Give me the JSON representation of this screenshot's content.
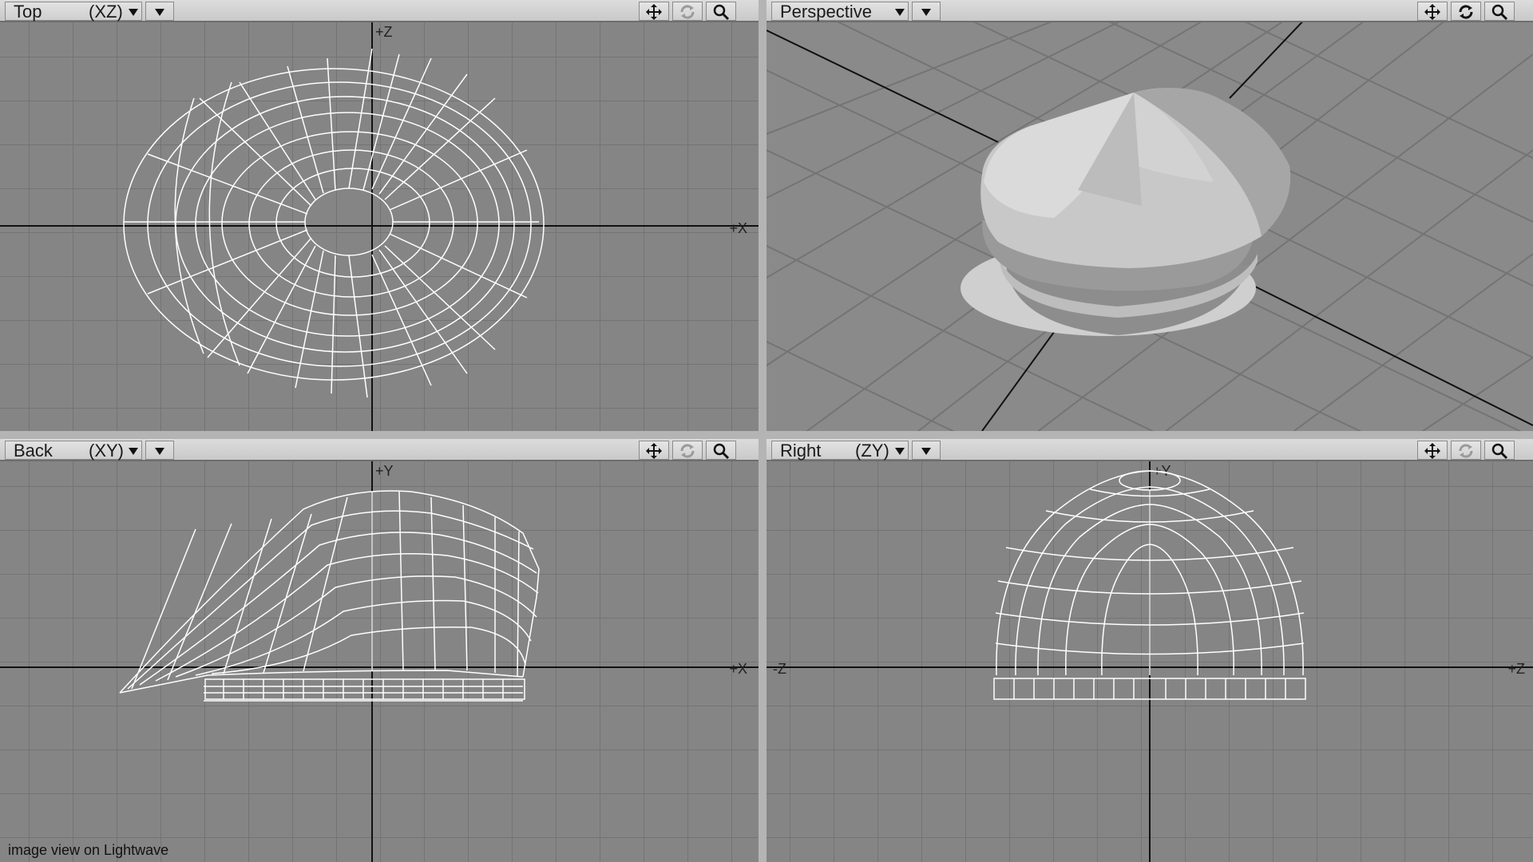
{
  "viewports": {
    "top": {
      "name": "Top",
      "axes": "(XZ)",
      "pos_x": "+X",
      "pos_z": "+Z"
    },
    "perspective": {
      "name": "Perspective"
    },
    "back": {
      "name": "Back",
      "axes": "(XY)",
      "pos_x": "+X",
      "pos_y": "+Y"
    },
    "right": {
      "name": "Right",
      "axes": "(ZY)",
      "neg_z": "-Z",
      "pos_z": "+Z",
      "pos_y": "+Y"
    }
  },
  "toolbar_icons": [
    "move-icon",
    "rotate-icon",
    "zoom-icon"
  ],
  "footer": {
    "caption": "image view on Lightwave"
  },
  "colors": {
    "viewport_bg": "#858585",
    "grid": "#747474",
    "axis": "#111111",
    "wire": "#ffffff",
    "toolbar": "#d4d4d4"
  }
}
